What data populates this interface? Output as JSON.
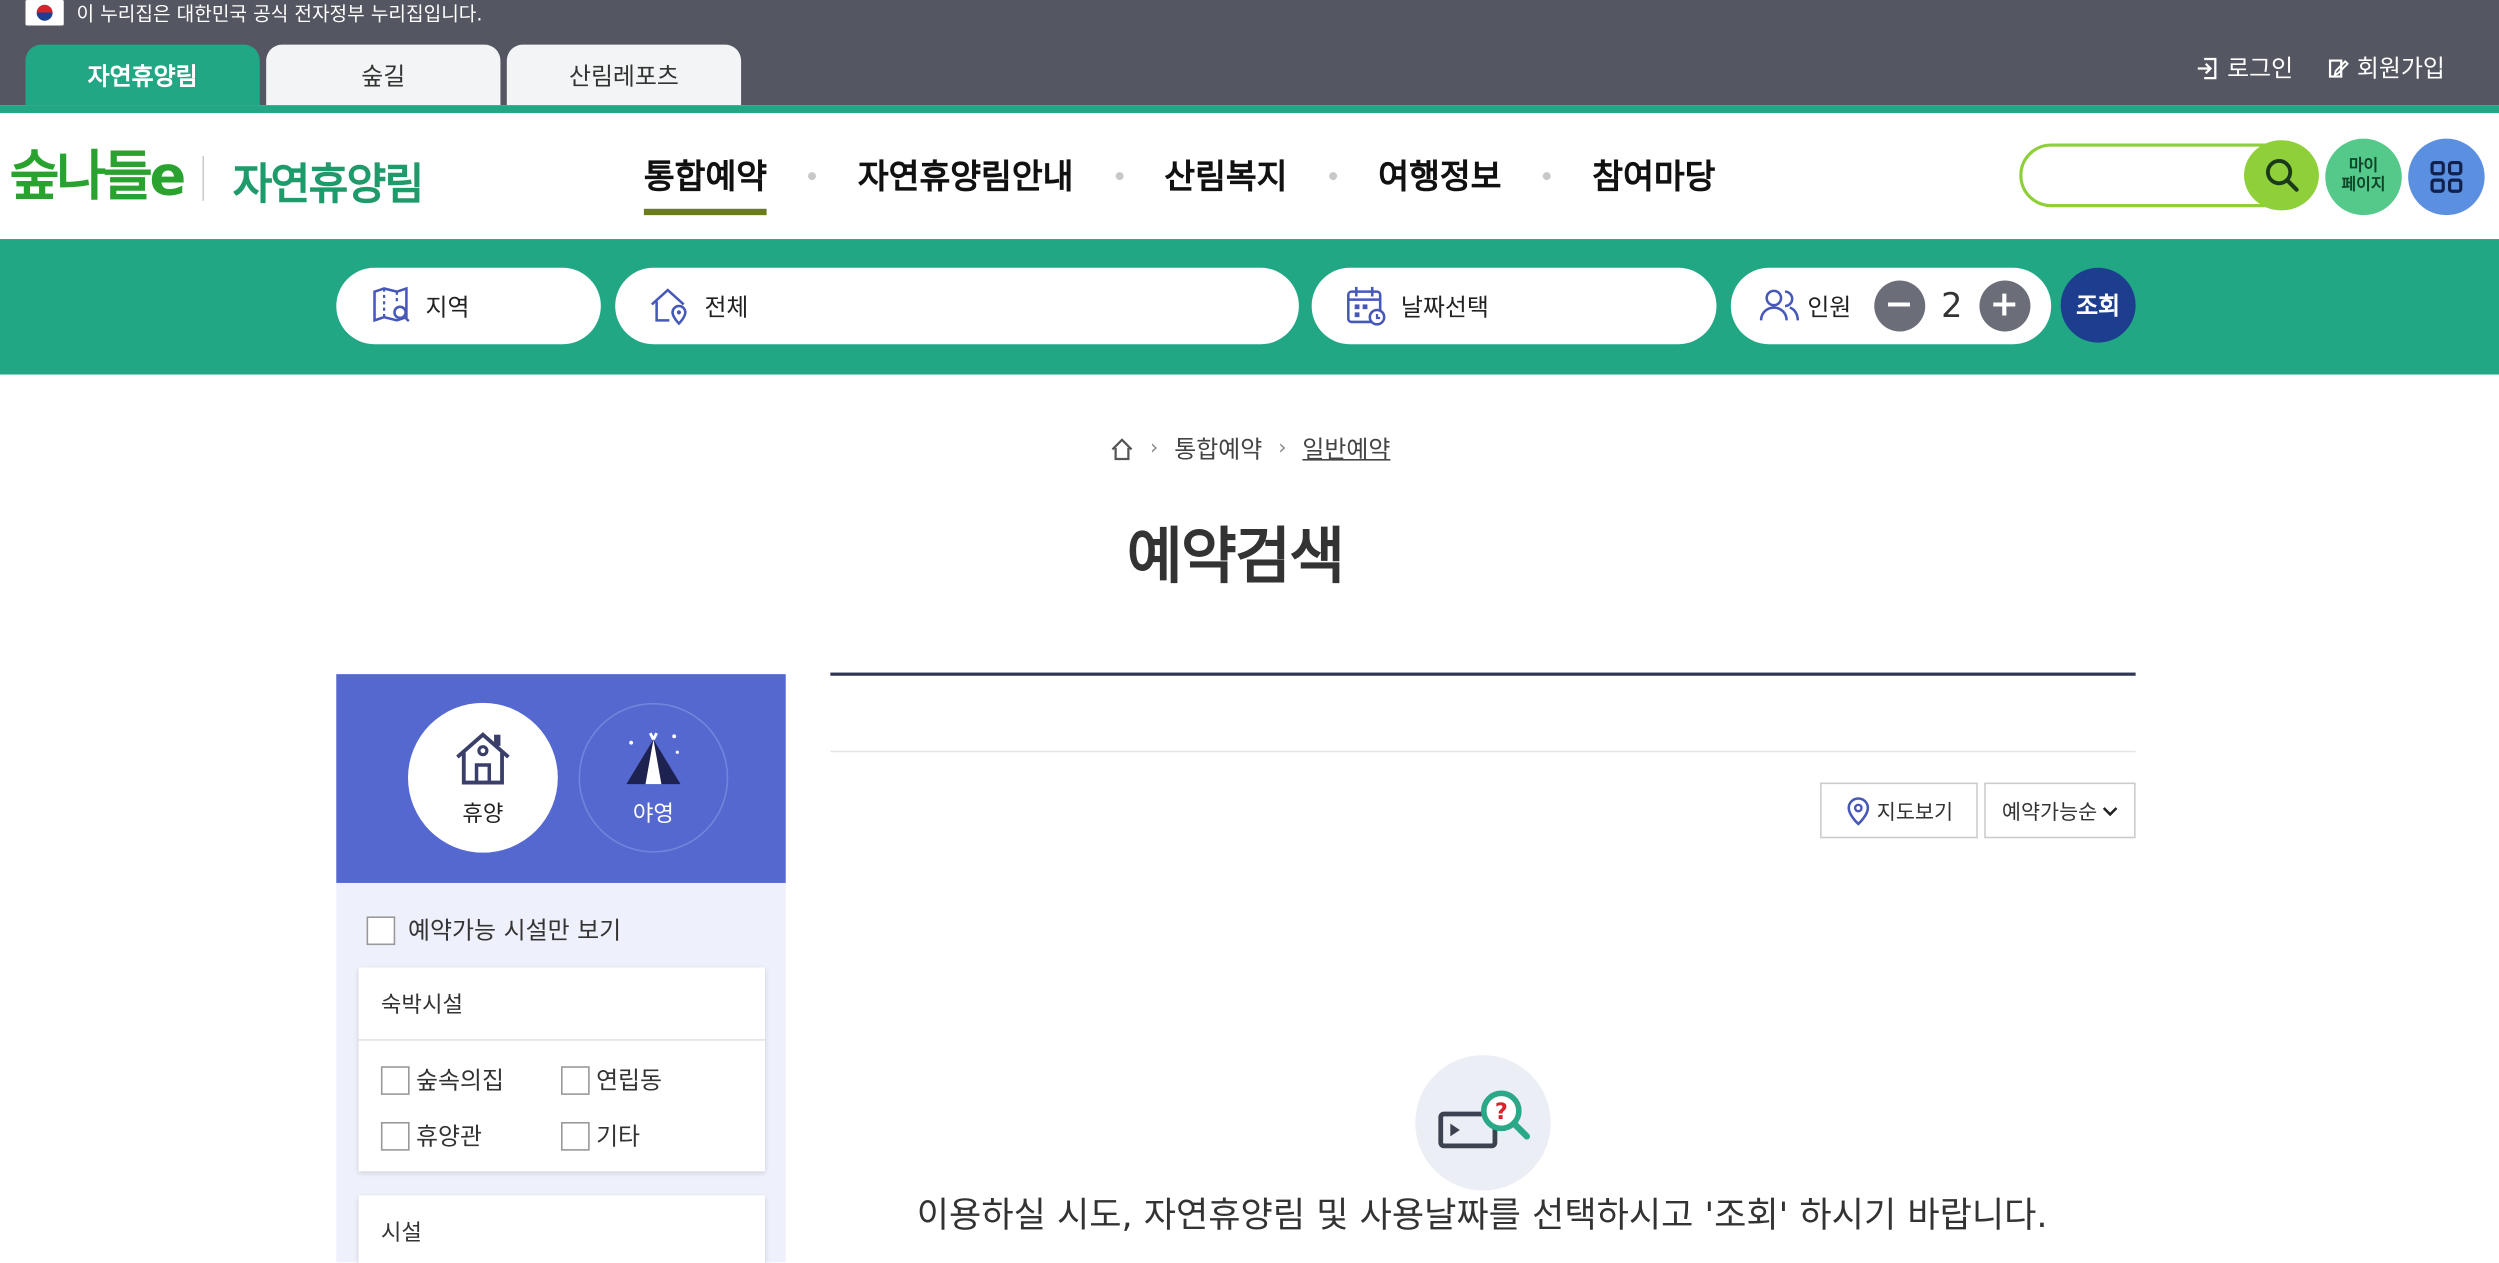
{
  "gov_bar": {
    "notice": "이 누리집은 대한민국 공식 전자정부 누리집입니다.",
    "tabs": [
      {
        "label": "자연휴양림",
        "active": true
      },
      {
        "label": "숲길",
        "active": false
      },
      {
        "label": "산림레포츠",
        "active": false
      }
    ],
    "login": "로그인",
    "signup": "회원가입"
  },
  "header": {
    "logo": "숲나들e",
    "logo_sub": "자연휴양림",
    "nav": [
      {
        "label": "통합예약",
        "active": true
      },
      {
        "label": "자연휴양림안내",
        "active": false
      },
      {
        "label": "산림복지",
        "active": false
      },
      {
        "label": "여행정보",
        "active": false
      },
      {
        "label": "참여마당",
        "active": false
      }
    ],
    "search_value": "",
    "mypage_label_1": "마이",
    "mypage_label_2": "페이지"
  },
  "search_strip": {
    "region": "지역",
    "resort": "전체",
    "date": "날짜선택",
    "people_label": "인원",
    "people_count": "2",
    "minus": "−",
    "plus": "+",
    "submit": "조회"
  },
  "breadcrumb": {
    "items": [
      "통합예약",
      "일반예약"
    ]
  },
  "page_title": "예약검색",
  "sidebar": {
    "types": [
      {
        "label": "휴양",
        "active": true
      },
      {
        "label": "야영",
        "active": false
      }
    ],
    "available_only": "예약가능 시설만 보기",
    "lodging": {
      "title": "숙박시설",
      "options": [
        "숲속의집",
        "연립동",
        "휴양관",
        "기타"
      ]
    },
    "facility": {
      "title": "시설"
    }
  },
  "results": {
    "map_view": "지도보기",
    "sort": "예약가능순",
    "empty_message": "이용하실 시도, 자연휴양림 및 사용날짜를 선택하시고 '조회' 하시기 바랍니다."
  },
  "colors": {
    "brand_green": "#22a785",
    "navy": "#1d3e8f",
    "sidebar_blue": "#5468d0",
    "lime": "#8fcf3a"
  }
}
